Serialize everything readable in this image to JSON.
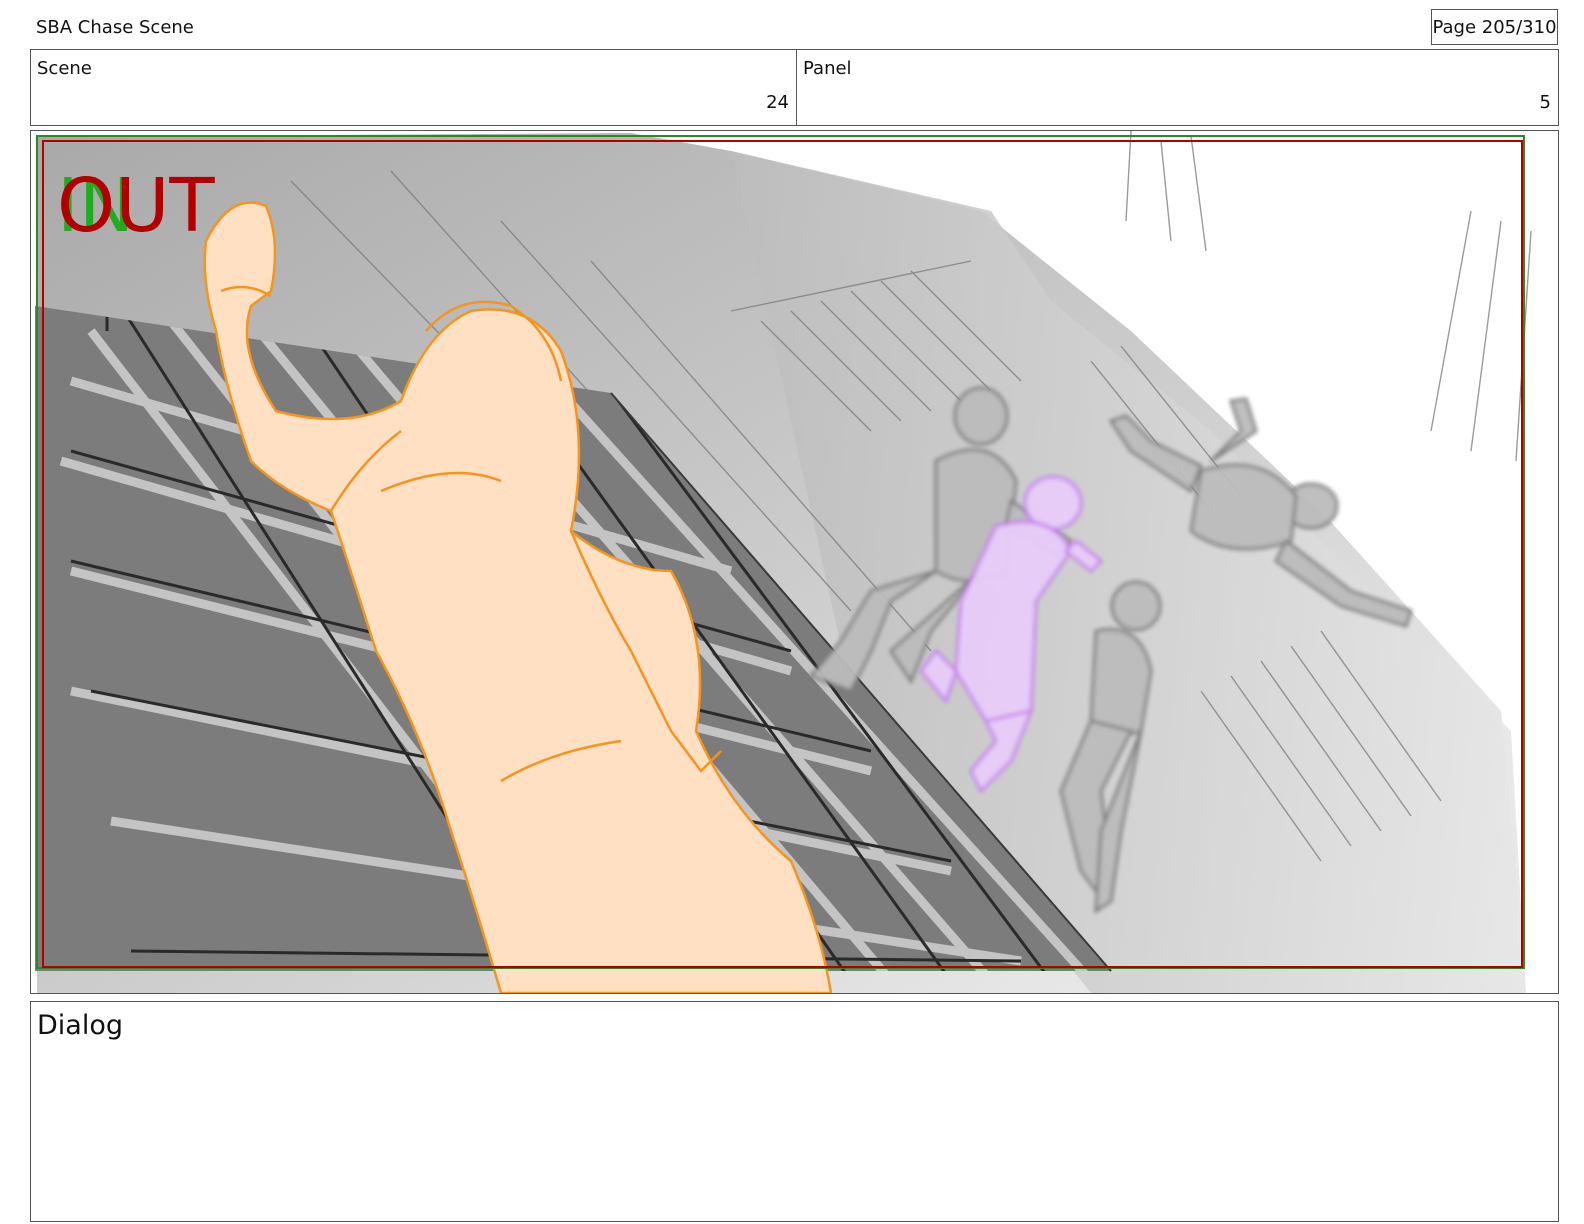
{
  "header": {
    "title": "SBA Chase Scene",
    "page": "Page 205/310"
  },
  "info": {
    "scene_label": "Scene",
    "scene_value": "24",
    "panel_label": "Panel",
    "panel_value": "5"
  },
  "frame": {
    "in_marker": "IN",
    "out_marker": "OUT",
    "colors": {
      "in_marker": "#22aa22",
      "out_marker": "#b00000",
      "safe_outer": "#2a8a2a",
      "safe_inner": "#b00000",
      "foreground_character": "#f5941e",
      "foreground_fill": "#ffe0c2",
      "highlight_character": "#c87cf0",
      "background_characters": "#8a8a8a"
    }
  },
  "dialog": {
    "label": "Dialog"
  }
}
